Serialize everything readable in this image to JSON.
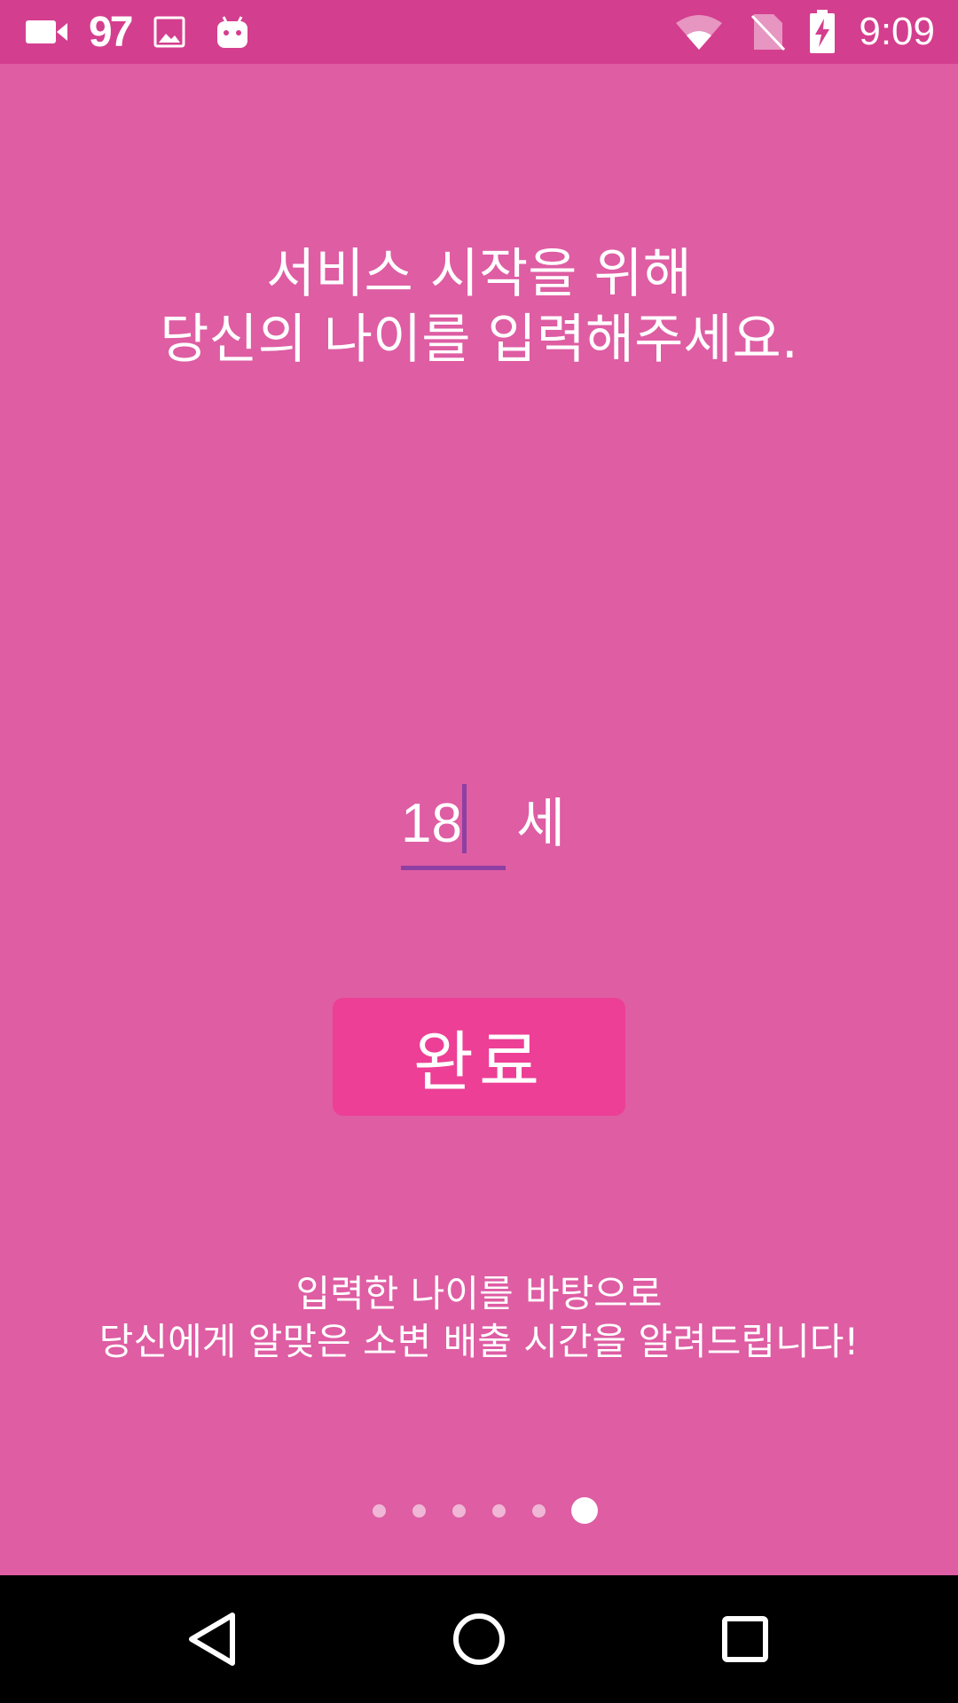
{
  "status_bar": {
    "notification_count": "97",
    "time": "9:09",
    "icons": [
      "video-camera-icon",
      "image-icon",
      "android-icon",
      "wifi-icon",
      "no-sim-icon",
      "battery-charging-icon"
    ]
  },
  "headline": {
    "line1": "서비스 시작을 위해",
    "line2": "당신의 나이를 입력해주세요."
  },
  "age_input": {
    "value": "18",
    "unit": "세"
  },
  "done_button": {
    "label": "완료"
  },
  "description": {
    "line1": "입력한 나이를 바탕으로",
    "line2": "당신에게 알맞은 소변 배출 시간을 알려드립니다!"
  },
  "pager": {
    "total": 6,
    "active_index": 5
  },
  "nav_bar": {
    "buttons": [
      "back-icon",
      "home-icon",
      "recents-icon"
    ]
  },
  "colors": {
    "background": "#DE5DA3",
    "status_bar": "#D43E8E",
    "button": "#EC3F95",
    "input_underline": "#8E3FA2",
    "nav_bar": "#000000"
  }
}
